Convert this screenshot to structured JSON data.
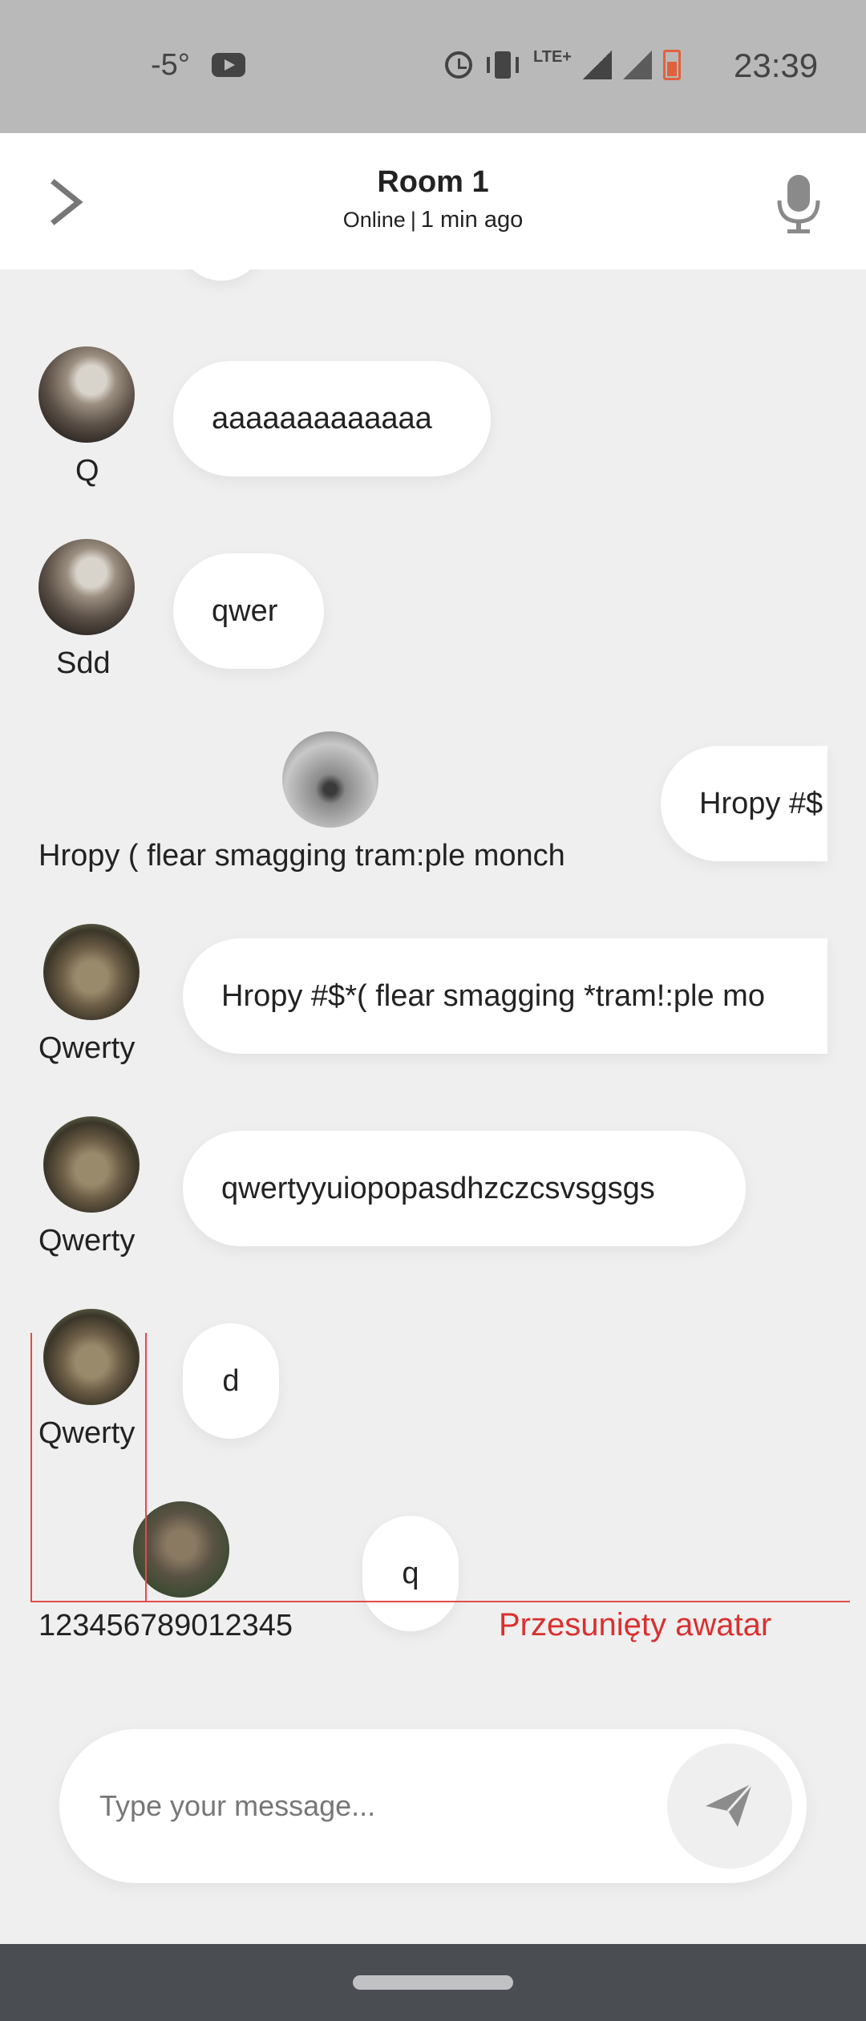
{
  "status_bar": {
    "temperature": "-5°",
    "network": "LTE+",
    "time": "23:39",
    "icons": [
      "youtube-icon",
      "alarm-icon",
      "vibrate-icon",
      "signal-icon",
      "signal-icon",
      "battery-icon"
    ]
  },
  "header": {
    "title": "Room 1",
    "status": "Online",
    "separator": "|",
    "last_seen": "1 min ago"
  },
  "messages": [
    {
      "name": "Q",
      "text": "aaaaaaaaaaaaa"
    },
    {
      "name": "Sdd",
      "text": "qwer"
    },
    {
      "name": "Hropy ( flear smagging tram:ple monch",
      "text": "Hropy #$"
    },
    {
      "name": "Qwerty",
      "text": "Hropy #$*( flear smagging *tram!:ple mo"
    },
    {
      "name": "Qwerty",
      "text": "qwertyyuiopopasdhzczcsvsgsgs"
    },
    {
      "name": "Qwerty",
      "text": "d"
    },
    {
      "name": "123456789012345",
      "text": "q"
    }
  ],
  "debug": {
    "label": "Przesunięty awatar",
    "color": "#d9302f"
  },
  "composer": {
    "placeholder": "Type your message...",
    "send_icon": "send-icon"
  },
  "colors": {
    "background": "#efefef",
    "bubble": "#ffffff",
    "status_bar": "#b9b9b9",
    "nav_bar": "#4a4e53"
  }
}
